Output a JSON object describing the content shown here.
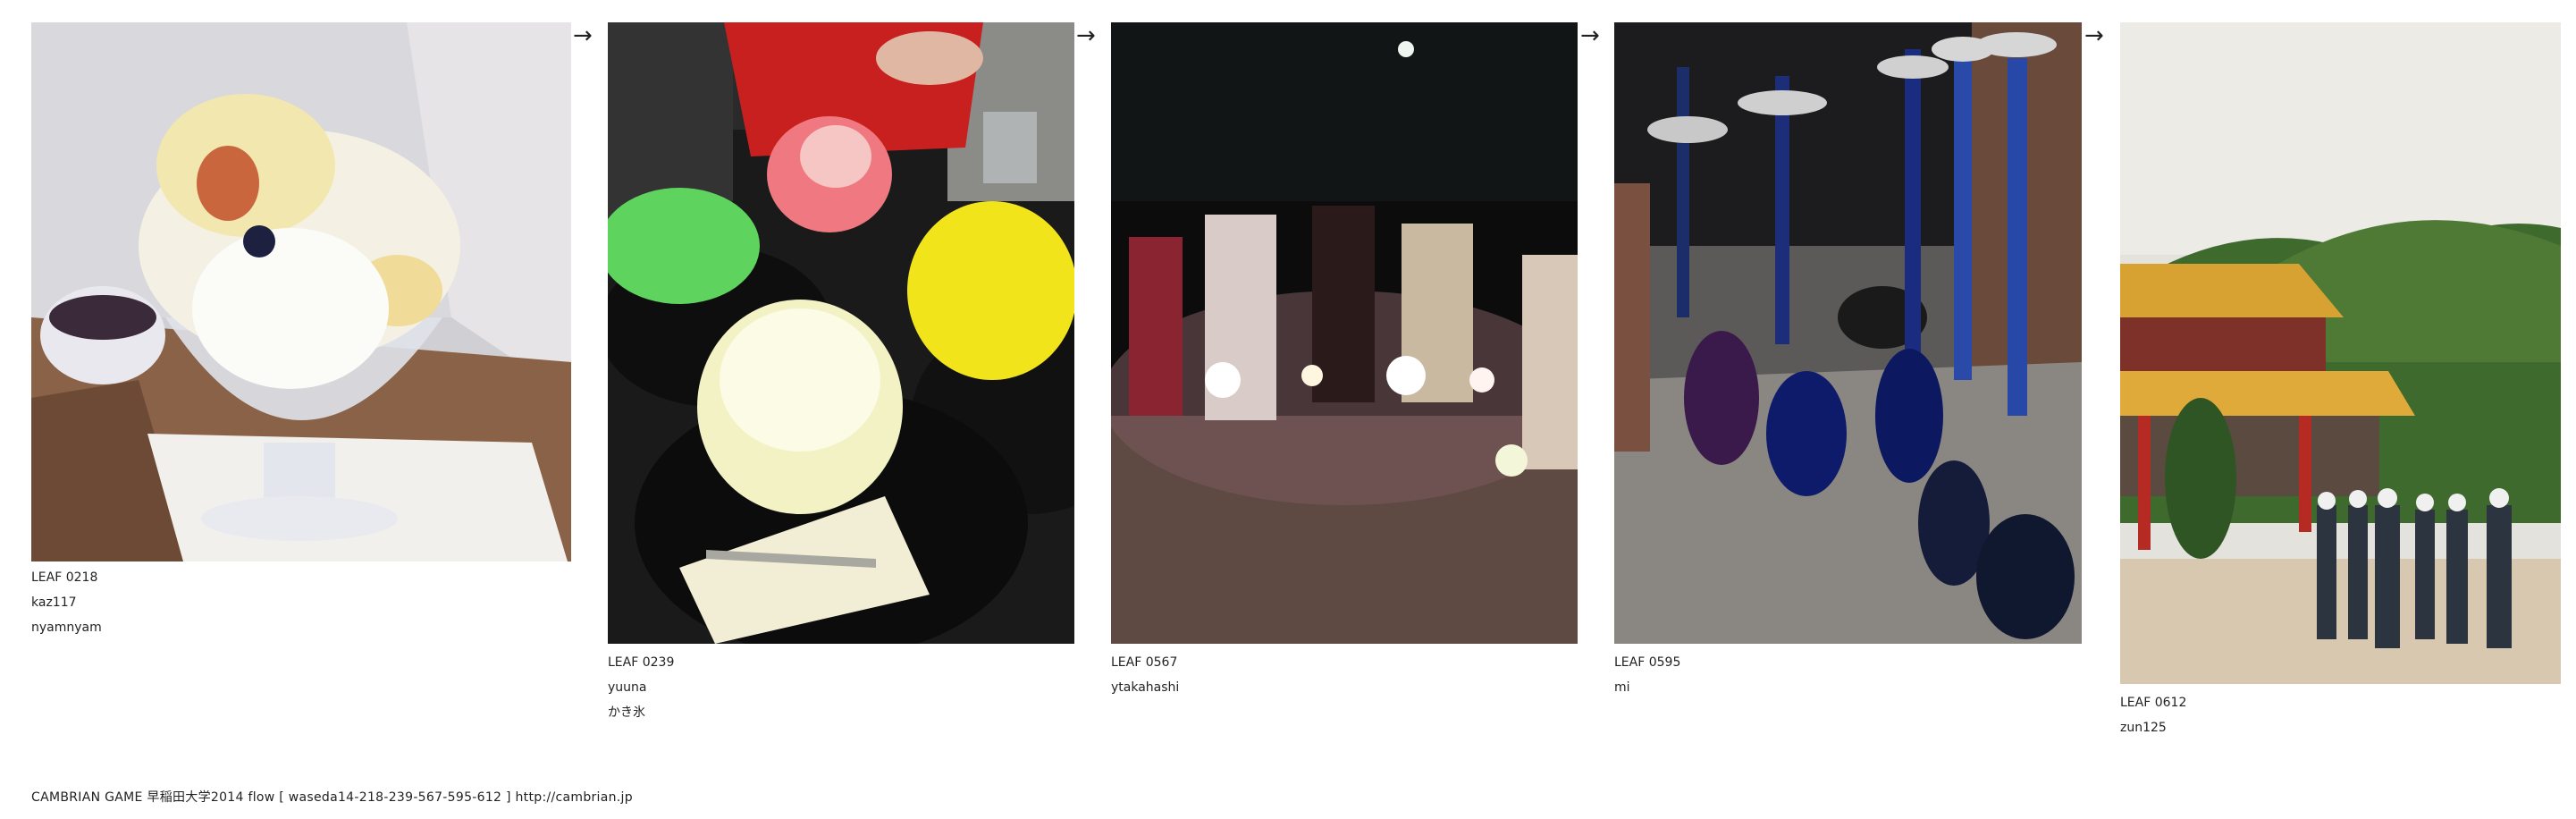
{
  "arrow_glyph": "→",
  "leaves": [
    {
      "id": "LEAF 0218",
      "user": "kaz117",
      "title": "nyamnyam",
      "subject": "shaved-ice-dessert-photo"
    },
    {
      "id": "LEAF 0239",
      "user": "yuuna",
      "title": "かき氷",
      "subject": "kakigori-table-photo"
    },
    {
      "id": "LEAF 0567",
      "user": "ytakahashi",
      "subject": "sparklers-night-photo"
    },
    {
      "id": "LEAF 0595",
      "user": "mi",
      "subject": "hookah-pipes-photo"
    },
    {
      "id": "LEAF 0612",
      "user": "zun125",
      "subject": "honor-guard-temple-photo"
    }
  ],
  "footer": {
    "text": "CAMBRIAN GAME  早稲田大学2014  flow [ waseda14-218-239-567-595-612 ]    http://cambrian.jp"
  }
}
